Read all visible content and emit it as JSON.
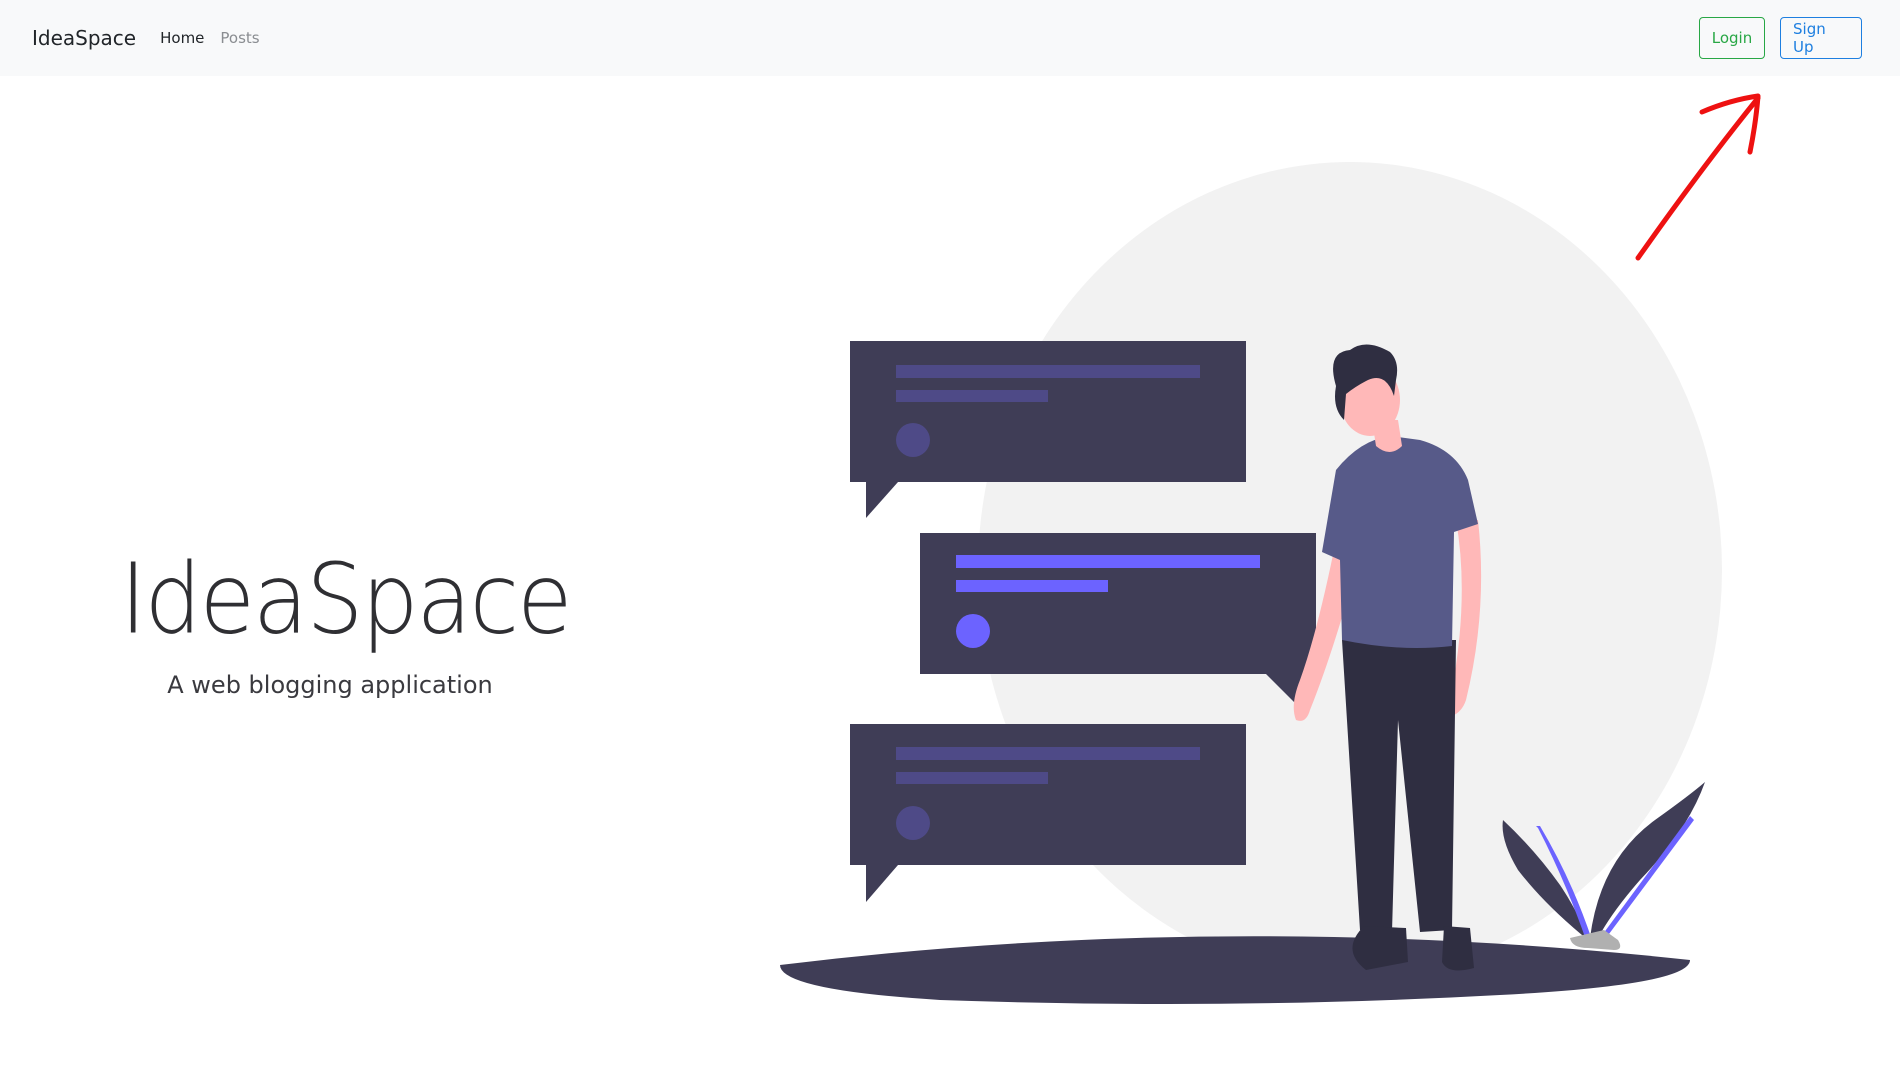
{
  "navbar": {
    "brand": "IdeaSpace",
    "links": {
      "home": "Home",
      "posts": "Posts"
    },
    "buttons": {
      "login": "Login",
      "signup": "Sign Up"
    }
  },
  "hero": {
    "title": "IdeaSpace",
    "subtitle": "A web blogging application"
  },
  "colors": {
    "navbar_bg": "#f8f9fa",
    "login_accent": "#28a745",
    "signup_accent": "#1e7fe0",
    "bubble_dark": "#3f3d56",
    "accent_purple": "#6c63ff",
    "annotation_arrow": "#ee1111"
  },
  "icons": {
    "annotation": "red-arrow-icon",
    "illustration": "person-with-chat-bubbles"
  }
}
